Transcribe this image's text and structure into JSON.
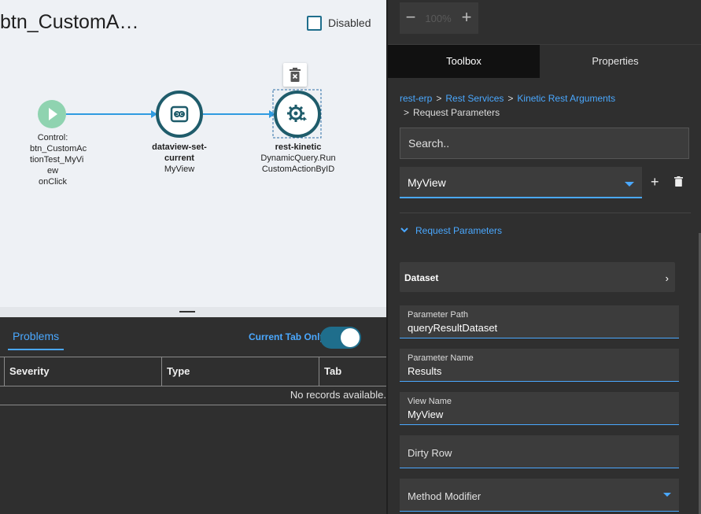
{
  "canvas": {
    "title": "btn_CustomA…",
    "disabled_label": "Disabled",
    "nodes": [
      {
        "lines": [
          "Control:",
          "btn_CustomAc",
          "tionTest_MyVi",
          "ew",
          "onClick"
        ]
      },
      {
        "title": "dataview-set-current",
        "subtitle": "MyView"
      },
      {
        "title": "rest-kinetic",
        "subtitle": "DynamicQuery.RunCustomActionByID"
      }
    ]
  },
  "problems": {
    "tab_label": "Problems",
    "current_tab_only": "Current Tab Only",
    "columns": [
      "Severity",
      "Type",
      "Tab"
    ],
    "empty_text": "No records available."
  },
  "zoom": {
    "value": "100%"
  },
  "tabs": {
    "toolbox": "Toolbox",
    "properties": "Properties"
  },
  "breadcrumb": {
    "items": [
      "rest-erp",
      "Rest Services",
      "Kinetic Rest Arguments"
    ],
    "current": "Request Parameters",
    "separator": ">"
  },
  "search": {
    "placeholder": "Search.."
  },
  "view_select": {
    "value": "MyView"
  },
  "section": {
    "label": "Request Parameters"
  },
  "dataset": {
    "label": "Dataset"
  },
  "fields": {
    "parameter_path": {
      "label": "Parameter Path",
      "value": "queryResultDataset"
    },
    "parameter_name": {
      "label": "Parameter Name",
      "value": "Results"
    },
    "view_name": {
      "label": "View Name",
      "value": "MyView"
    },
    "dirty_row": {
      "label": "Dirty Row"
    },
    "method_modifier": {
      "label": "Method Modifier"
    }
  },
  "colors": {
    "accent": "#4aa8ff",
    "node_teal": "#1f5c6b",
    "start_green": "#8fd3b0",
    "connector": "#2f9be0"
  }
}
